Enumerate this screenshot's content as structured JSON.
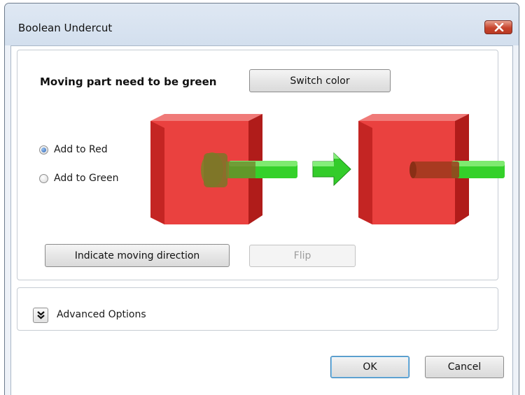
{
  "window": {
    "title": "Boolean Undercut"
  },
  "main": {
    "heading": "Moving part need to be green",
    "switch_color_label": "Switch color",
    "radio_options": [
      {
        "label": "Add to Red",
        "checked": true
      },
      {
        "label": "Add to Green",
        "checked": false
      }
    ],
    "indicate_direction_label": "Indicate moving direction",
    "flip_label": "Flip"
  },
  "advanced": {
    "label": "Advanced Options"
  },
  "footer": {
    "ok_label": "OK",
    "cancel_label": "Cancel"
  },
  "colors": {
    "red_part": "#e8312f",
    "green_part": "#34d12a",
    "title_bar": "#d6e2ef",
    "close_button": "#c7442d"
  }
}
